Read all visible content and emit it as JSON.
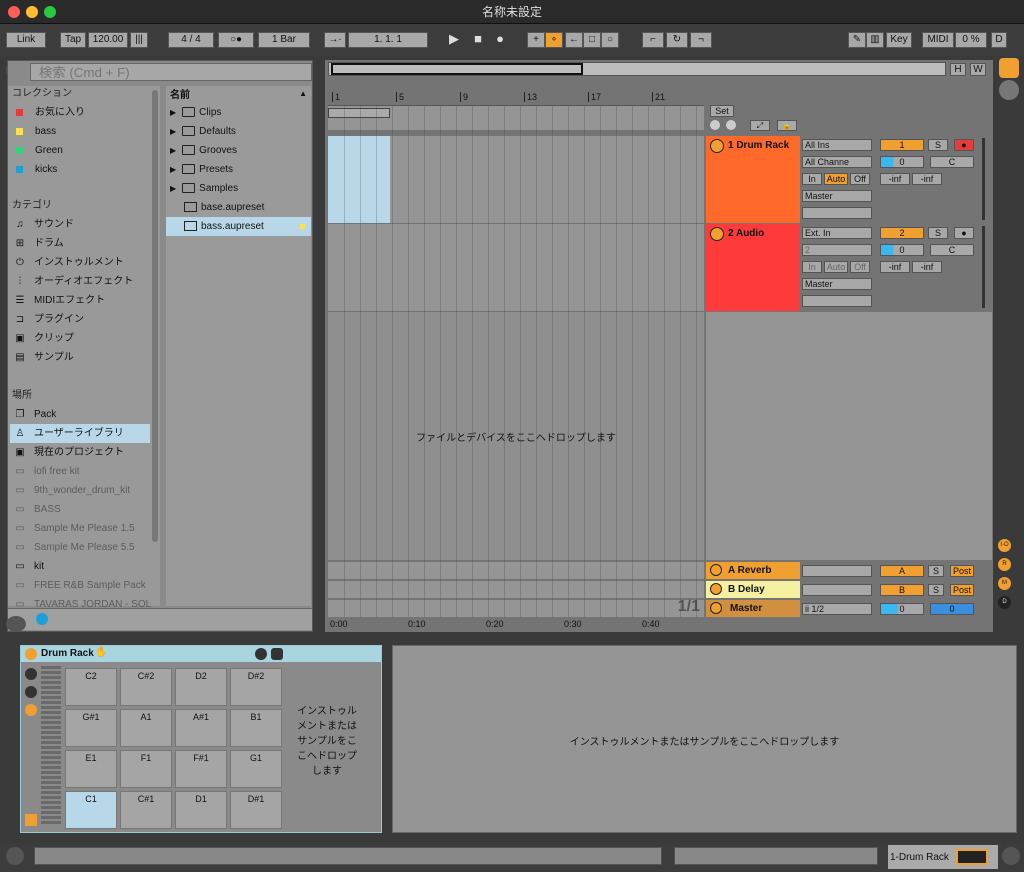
{
  "title": "名称未設定",
  "controlbar": {
    "link": "Link",
    "tap": "Tap",
    "tempo": "120.00",
    "sig": "4 / 4",
    "metro": "○●",
    "quant": "1 Bar",
    "position": "1.   1.   1",
    "key": "Key",
    "midi": "MIDI",
    "cpu": "0 %",
    "d": "D"
  },
  "browser": {
    "search_placeholder": "検索 (Cmd + F)",
    "collections_head": "コレクション",
    "collections": [
      {
        "label": "お気に入り",
        "color": "#e43b3b"
      },
      {
        "label": "bass",
        "color": "#ffe24a"
      },
      {
        "label": "Green",
        "color": "#2fd37f"
      },
      {
        "label": "kicks",
        "color": "#1e9fd9"
      }
    ],
    "categories_head": "カテゴリ",
    "categories": [
      {
        "label": "サウンド",
        "icon": "♫"
      },
      {
        "label": "ドラム",
        "icon": "⊞"
      },
      {
        "label": "インストゥルメント",
        "icon": "⏻"
      },
      {
        "label": "オーディオエフェクト",
        "icon": "⫶"
      },
      {
        "label": "MIDIエフェクト",
        "icon": "☰"
      },
      {
        "label": "プラグイン",
        "icon": "⊐"
      },
      {
        "label": "クリップ",
        "icon": "▣"
      },
      {
        "label": "サンプル",
        "icon": "▤"
      }
    ],
    "places_head": "場所",
    "places": [
      {
        "label": "Pack",
        "icon": "❐"
      },
      {
        "label": "ユーザーライブラリ",
        "icon": "♙"
      },
      {
        "label": "現在のプロジェクト",
        "icon": "▣"
      },
      {
        "label": "lofi free kit",
        "icon": "▭"
      },
      {
        "label": "9th_wonder_drum_kit",
        "icon": "▭"
      },
      {
        "label": "BASS",
        "icon": "▭"
      },
      {
        "label": "Sample Me Please 1.5",
        "icon": "▭"
      },
      {
        "label": "Sample Me Please 5.5",
        "icon": "▭"
      },
      {
        "label": "kit",
        "icon": "▭"
      },
      {
        "label": "FREE R&B Sample Pack",
        "icon": "▭"
      },
      {
        "label": "TAVARAS JORDAN - SOL",
        "icon": "▭"
      }
    ],
    "files_head": "名前",
    "files": [
      "Clips",
      "Defaults",
      "Grooves",
      "Presets",
      "Samples",
      "base.aupreset",
      "bass.aupreset"
    ]
  },
  "arrange": {
    "ruler": [
      "1",
      "5",
      "9",
      "13",
      "17",
      "21"
    ],
    "set": "Set",
    "drop_text": "ファイルとデバイスをここへドロップします",
    "page": "1/1",
    "times": [
      "0:00",
      "0:10",
      "0:20",
      "0:30",
      "0:40"
    ],
    "tracks": [
      {
        "name": "1 Drum Rack",
        "color": "#ff6a2a",
        "in": "All Ins",
        "ch": "All Channe",
        "mon": [
          "In",
          "Auto",
          "Off"
        ],
        "out": "Master",
        "num": "1",
        "s": "S",
        "vol": "0",
        "pan": "C",
        "l": "-inf",
        "r": "-inf"
      },
      {
        "name": "2 Audio",
        "color": "#ff3a3a",
        "in": "Ext. In",
        "ch": "2",
        "mon": [
          "In",
          "Auto",
          "Off"
        ],
        "out": "Master",
        "num": "2",
        "s": "S",
        "vol": "0",
        "pan": "C",
        "l": "-inf",
        "r": "-inf"
      }
    ],
    "returns": [
      {
        "name": "A Reverb",
        "color": "#f0a030",
        "id": "A",
        "s": "S",
        "post": "Post"
      },
      {
        "name": "B Delay",
        "color": "#f5f0a0",
        "id": "B",
        "s": "S",
        "post": "Post"
      }
    ],
    "master": {
      "name": "Master",
      "color": "#d09040",
      "sel": "ii 1/2",
      "vol": "0",
      "vol2": "0"
    },
    "side_letters": [
      "I·O",
      "R",
      "M",
      "D"
    ]
  },
  "detail": {
    "title": "Drum Rack",
    "pads": [
      [
        "C2",
        "C#2",
        "D2",
        "D#2"
      ],
      [
        "G#1",
        "A1",
        "A#1",
        "B1"
      ],
      [
        "E1",
        "F1",
        "F#1",
        "G1"
      ],
      [
        "C1",
        "C#1",
        "D1",
        "D#1"
      ]
    ],
    "drop_small": "インストゥルメントまたはサンプルをここへドロップします",
    "drop_big": "インストゥルメントまたはサンプルをここへドロップします"
  },
  "status": {
    "track": "1-Drum Rack"
  }
}
